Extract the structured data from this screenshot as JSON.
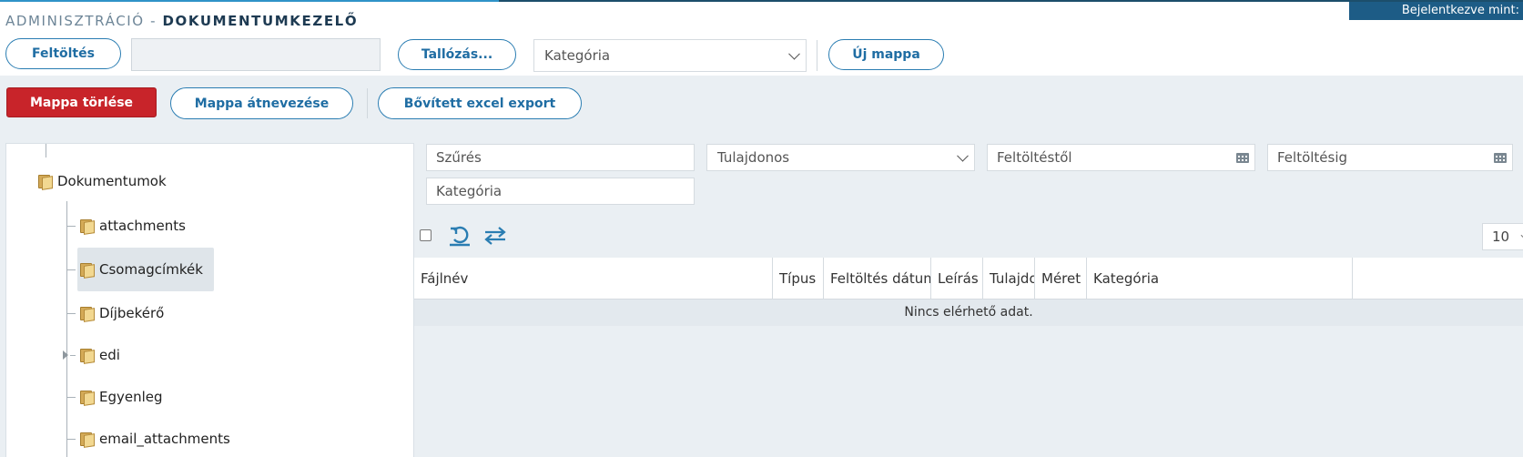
{
  "header": {
    "breadcrumb_section": "ADMINISZTRÁCIÓ",
    "breadcrumb_separator": "-",
    "breadcrumb_page": "DOKUMENTUMKEZELŐ",
    "login_status": "Bejelentkezve mint:"
  },
  "toolbar": {
    "upload_label": "Feltöltés",
    "browse_label": "Tallózás...",
    "category_select": "Kategória",
    "new_folder_label": "Új mappa",
    "delete_folder_label": "Mappa törlése",
    "rename_folder_label": "Mappa átnevezése",
    "excel_export_label": "Bővített excel export"
  },
  "tree": {
    "root": "Dokumentumok",
    "items": [
      {
        "label": "attachments"
      },
      {
        "label": "Csomagcímkék",
        "selected": true
      },
      {
        "label": "Díjbekérő"
      },
      {
        "label": "edi",
        "expandable": true
      },
      {
        "label": "Egyenleg"
      },
      {
        "label": "email_attachments"
      }
    ]
  },
  "filters": {
    "search_placeholder": "Szűrés",
    "owner_select": "Tulajdonos",
    "upload_from_placeholder": "Feltöltéstől",
    "upload_to_placeholder": "Feltöltésig",
    "category_placeholder": "Kategória"
  },
  "grid": {
    "page_size": "10",
    "columns": [
      "Fájlnév",
      "Típus",
      "Feltöltés dátuma",
      "Leírás",
      "Tulajdonos",
      "Méret",
      "Kategória"
    ],
    "empty_text": "Nincs elérhető adat."
  },
  "colors": {
    "accent": "#2a7db2",
    "danger": "#c8242a",
    "header_dark": "#1d5c86",
    "panel_bg": "#eaeff3"
  }
}
